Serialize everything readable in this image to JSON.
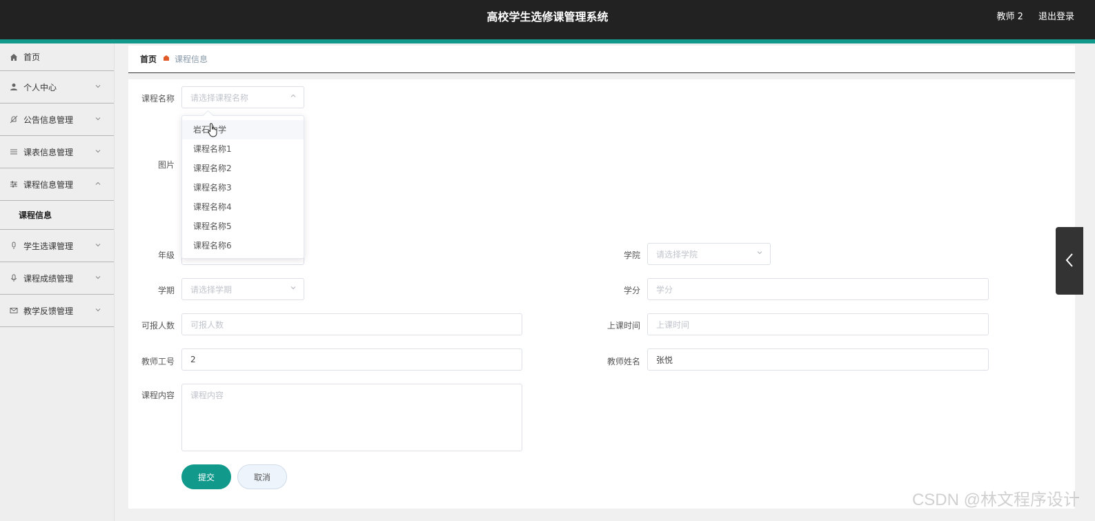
{
  "header": {
    "title": "高校学生选修课管理系统",
    "user": "教师 2",
    "logout": "退出登录"
  },
  "sidebar": {
    "items": [
      {
        "label": "首页",
        "icon": "home-icon"
      },
      {
        "label": "个人中心",
        "icon": "user-icon"
      },
      {
        "label": "公告信息管理",
        "icon": "bell-off-icon"
      },
      {
        "label": "课表信息管理",
        "icon": "list-icon"
      },
      {
        "label": "课程信息管理",
        "icon": "sliders-icon"
      },
      {
        "label": "学生选课管理",
        "icon": "microphone-icon"
      },
      {
        "label": "课程成绩管理",
        "icon": "microphone-icon"
      },
      {
        "label": "教学反馈管理",
        "icon": "mail-icon"
      }
    ],
    "submenu_label": "课程信息"
  },
  "breadcrumb": {
    "home": "首页",
    "current": "课程信息"
  },
  "form": {
    "course_name_label": "课程名称",
    "course_name_placeholder": "请选择课程名称",
    "image_label": "图片",
    "grade_label": "年级",
    "college_label": "学院",
    "college_placeholder": "请选择学院",
    "term_label": "学期",
    "term_placeholder": "请选择学期",
    "credit_label": "学分",
    "credit_placeholder": "学分",
    "capacity_label": "可报人数",
    "capacity_placeholder": "可报人数",
    "class_time_label": "上课时间",
    "class_time_placeholder": "上课时间",
    "teacher_id_label": "教师工号",
    "teacher_id_value": "2",
    "teacher_name_label": "教师姓名",
    "teacher_name_value": "张悦",
    "content_label": "课程内容",
    "content_placeholder": "课程内容",
    "submit_label": "提交",
    "cancel_label": "取消"
  },
  "dropdown": {
    "options": [
      "岩石力学",
      "课程名称1",
      "课程名称2",
      "课程名称3",
      "课程名称4",
      "课程名称5",
      "课程名称6"
    ]
  },
  "watermark": "CSDN @林文程序设计",
  "colors": {
    "accent": "#119a8c",
    "header_bg": "#222222"
  }
}
